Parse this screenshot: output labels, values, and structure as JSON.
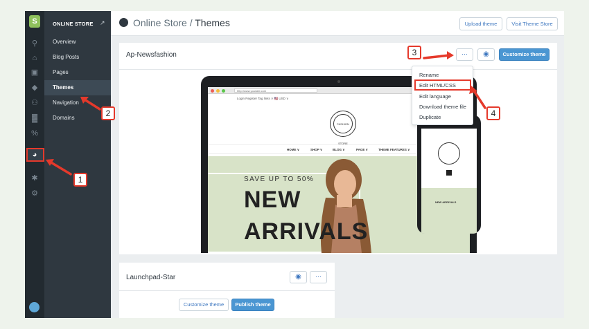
{
  "sidebar": {
    "title": "ONLINE STORE",
    "items": [
      {
        "label": "Overview"
      },
      {
        "label": "Blog Posts"
      },
      {
        "label": "Pages"
      },
      {
        "label": "Themes"
      },
      {
        "label": "Navigation"
      },
      {
        "label": "Domains"
      }
    ]
  },
  "header": {
    "crumb": "Online Store",
    "separator": " / ",
    "title": "Themes",
    "upload_label": "Upload theme",
    "store_label": "Visit Theme Store"
  },
  "theme_main": {
    "name": "Ap-Newsfashion",
    "more_label": "···",
    "customize_label": "Customize theme"
  },
  "dropdown": {
    "items": [
      {
        "label": "Rename"
      },
      {
        "label": "Edit HTML/CSS"
      },
      {
        "label": "Edit language"
      },
      {
        "label": "Download theme file"
      },
      {
        "label": "Duplicate"
      }
    ]
  },
  "preview": {
    "url": "http://www.yoursite.com",
    "topbar": "Login    Register    Tag links ∨    🇺🇸 USD ∨",
    "logo_text": "FASHION STORE",
    "nav": [
      "HOME ∨",
      "SHOP ∨",
      "BLOG ∨",
      "PAGE ∨",
      "THEME FEATURES ∨"
    ],
    "hero_small": "SAVE UP TO 50%",
    "hero_line1": "NEW",
    "hero_line2": "ARRIVALS",
    "phone_text": "NEW ARRIVALS"
  },
  "theme_second": {
    "name": "Launchpad-Star",
    "more_label": "···",
    "customize_label": "Customize theme",
    "publish_label": "Publish theme"
  },
  "callouts": [
    "1",
    "2",
    "3",
    "4"
  ],
  "colors": {
    "accent": "#4a96d2",
    "callout": "#e5392b",
    "rail": "#222a30",
    "sidebar": "#2f3840"
  },
  "icons": [
    "search-icon",
    "home-icon",
    "orders-icon",
    "tag-icon",
    "customers-icon",
    "reports-icon",
    "discounts-icon",
    "online-store-icon",
    "apps-icon",
    "settings-icon"
  ]
}
